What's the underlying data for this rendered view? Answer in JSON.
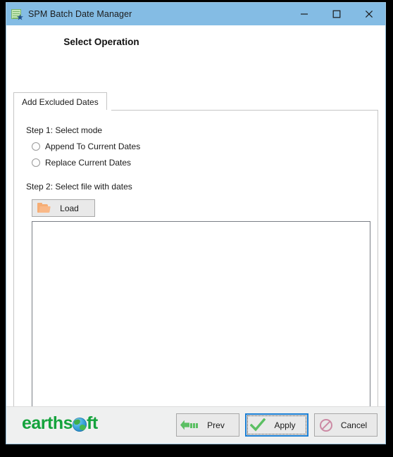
{
  "window": {
    "title": "SPM Batch Date Manager",
    "icon": "calendar-star-icon",
    "controls": {
      "minimize": "minimize-icon",
      "maximize": "maximize-icon",
      "close": "close-icon"
    }
  },
  "page": {
    "heading": "Select Operation"
  },
  "tabs": [
    {
      "label": "Add Excluded Dates",
      "selected": true
    }
  ],
  "form": {
    "step1_label": "Step 1: Select mode",
    "modes": [
      {
        "label": "Append To Current Dates",
        "selected": false
      },
      {
        "label": "Replace Current Dates",
        "selected": false
      }
    ],
    "step2_label": "Step 2: Select file with dates",
    "load_button": {
      "label": "Load",
      "icon": "folder-open-icon"
    },
    "dates_textarea": {
      "value": "",
      "placeholder": ""
    }
  },
  "footer": {
    "logo_text_before": "earths",
    "logo_text_after": "ft",
    "logo_globe": "globe-icon",
    "buttons": [
      {
        "label": "Prev",
        "icon": "arrow-left-icon",
        "focused": false
      },
      {
        "label": "Apply",
        "icon": "check-icon",
        "focused": true
      },
      {
        "label": "Cancel",
        "icon": "no-entry-icon",
        "focused": false
      }
    ]
  },
  "colors": {
    "titlebar": "#84bce4",
    "accent_focus": "#1b7fd4",
    "logo_green": "#14a33c",
    "folder_orange": "#f6ad74",
    "check_green": "#5bbf63",
    "cancel_pink": "#cc8aa4"
  }
}
